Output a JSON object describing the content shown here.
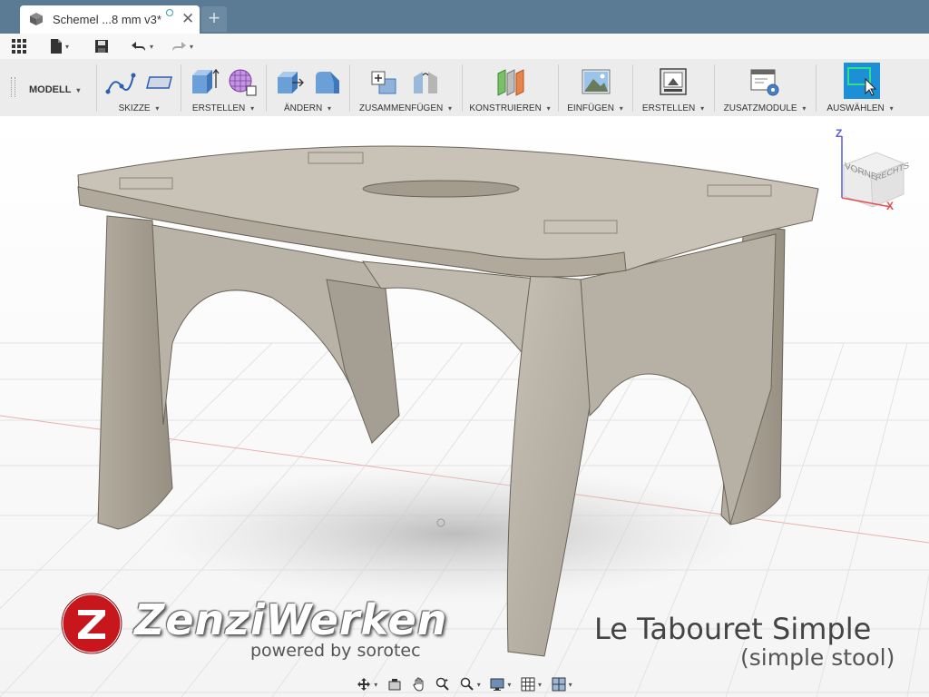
{
  "tab": {
    "title": "Schemel ...8 mm v3*",
    "close": "✕",
    "new": "+"
  },
  "workspace": {
    "label": "MODELL"
  },
  "ribbon": {
    "groups": [
      {
        "id": "sketch",
        "label": "SKIZZE"
      },
      {
        "id": "create",
        "label": "ERSTELLEN"
      },
      {
        "id": "modify",
        "label": "ÄNDERN"
      },
      {
        "id": "assemble",
        "label": "ZUSAMMENFÜGEN"
      },
      {
        "id": "construct",
        "label": "KONSTRUIEREN"
      },
      {
        "id": "insert",
        "label": "EINFÜGEN"
      },
      {
        "id": "make",
        "label": "ERSTELLEN"
      },
      {
        "id": "addins",
        "label": "ZUSATZMODULE"
      },
      {
        "id": "select",
        "label": "AUSWÄHLEN"
      }
    ],
    "caret": "▾"
  },
  "viewcube": {
    "front": "VORNE",
    "right": "RECHTS",
    "axis_z": "Z",
    "axis_x": "X"
  },
  "brand": {
    "name": "ZenziWerken",
    "powered": "powered by sorotec",
    "logo_letter": "Z"
  },
  "caption": {
    "title": "Le Tabouret Simple",
    "subtitle": "(simple stool)"
  },
  "colors": {
    "tabbar": "#5b7a94",
    "ribbon": "#ececec",
    "select_accent": "#1d8fd6",
    "brand_red": "#c8161d"
  }
}
